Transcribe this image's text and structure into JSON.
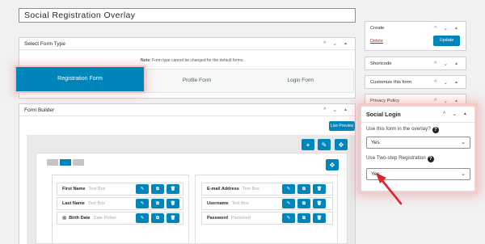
{
  "editor": {
    "title_value": "Social Registration Overlay"
  },
  "form_type": {
    "heading": "Select Form Type",
    "note_bold": "Note:",
    "note_text": " Form type cannot be changed for the default forms.",
    "tabs": [
      {
        "label": "Registration Form",
        "active": true
      },
      {
        "label": "Profile Form",
        "active": false
      },
      {
        "label": "Login Form",
        "active": false
      }
    ]
  },
  "builder": {
    "heading": "Form Builder",
    "live_preview": "Live Preview",
    "left_fields": [
      {
        "label": "First Name",
        "type": "Text Box"
      },
      {
        "label": "Last Name",
        "type": "Text Box"
      },
      {
        "label": "Birth Date",
        "type": "Date Picker"
      }
    ],
    "right_fields": [
      {
        "label": "E-mail Address",
        "type": "Text Box"
      },
      {
        "label": "Username",
        "type": "Text Box"
      },
      {
        "label": "Password",
        "type": "Password"
      }
    ]
  },
  "sidebar": {
    "create": {
      "title": "Create",
      "delete": "Delete",
      "update": "Update"
    },
    "shortcode": "Shortcode",
    "customize": "Customize this form",
    "privacy": "Privacy Policy"
  },
  "popup": {
    "title": "Social Login",
    "q1": "Use this form in the overlay?",
    "q1_value": "Yes",
    "q2": "Use Two-step Registration",
    "q2_value": "Yes"
  },
  "colors": {
    "accent": "#0085ba",
    "highlight": "#e0242f",
    "delete_link": "#b32d2e"
  },
  "icons": {
    "chevron_up": "^",
    "chevron_down": "⌄",
    "arrow_up": "▲",
    "plus": "+",
    "pencil": "✎",
    "move": "✥",
    "copy": "⧉",
    "trash": "🗑",
    "calendar": "▦",
    "help": "?"
  }
}
